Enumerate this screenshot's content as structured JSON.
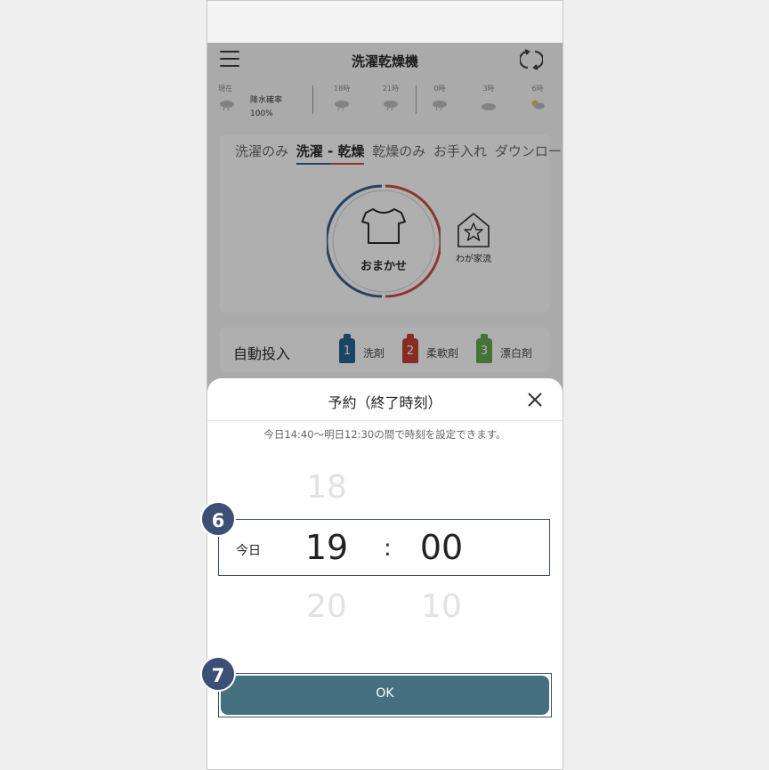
{
  "header": {
    "title": "洗濯乾燥機",
    "menu_icon": "hamburger-menu-icon",
    "refresh_icon": "refresh-icon"
  },
  "weather": {
    "now_label": "現在",
    "rain_label": "降水確率",
    "rain_value": "100%",
    "slots": [
      "18時",
      "21時",
      "0時",
      "3時",
      "6時"
    ]
  },
  "mode_tabs": [
    "洗濯のみ",
    "洗濯 - 乾燥",
    "乾燥のみ",
    "お手入れ",
    "ダウンロー"
  ],
  "dial_label": "おまかせ",
  "house_label": "わが家流",
  "auto": {
    "title": "自動投入",
    "items": [
      {
        "num": "1",
        "label": "洗剤",
        "color": "#1f5f8b"
      },
      {
        "num": "2",
        "label": "柔軟剤",
        "color": "#c0392b"
      },
      {
        "num": "3",
        "label": "漂白剤",
        "color": "#5da34a"
      }
    ]
  },
  "sheet": {
    "title": "予約（終了時刻）",
    "note": "今日14:40〜明日12:30の間で時刻を設定できます。",
    "day": "今日",
    "hours": {
      "prev": "18",
      "selected": "19",
      "next": "20"
    },
    "minutes": {
      "selected": "00",
      "next": "10"
    },
    "separator": ":",
    "ok_label": "OK"
  },
  "markers": [
    "6",
    "7"
  ],
  "colors": {
    "accent": "#3d4f75",
    "ok_button": "#45707f"
  }
}
